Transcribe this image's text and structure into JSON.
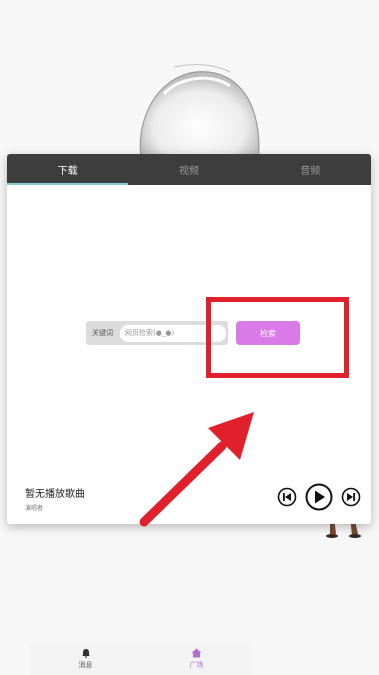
{
  "tabs": [
    {
      "label": "下载",
      "active": true
    },
    {
      "label": "视频",
      "active": false
    },
    {
      "label": "音频",
      "active": false
    }
  ],
  "search": {
    "keyword_label": "关键词",
    "placeholder": "网页检索(●_●)",
    "button_label": "检索"
  },
  "player": {
    "title": "暂无播放歌曲",
    "subtitle": "演唱者"
  },
  "bottom_nav": {
    "items": [
      {
        "label": "消息",
        "icon": "bell-icon",
        "active": false
      },
      {
        "label": "广场",
        "icon": "home-icon",
        "active": true
      }
    ]
  },
  "colors": {
    "tab_bar": "#3d3d3d",
    "tab_indicator": "#7fd0dc",
    "search_button": "#d87be6",
    "annotation": "#e0202a",
    "nav_active": "#b070d0"
  }
}
